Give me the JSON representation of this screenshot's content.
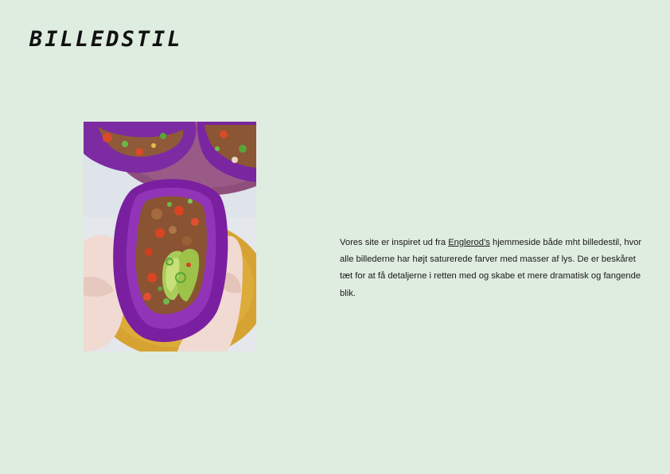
{
  "page": {
    "title": "BILLEDSTIL",
    "background_color": "#dfece0"
  },
  "photo": {
    "icon": "food-photo",
    "subject_colors": {
      "cabbage": "#7a1fa0",
      "plate_top": "#8a4a78",
      "plate_bottom": "#d8a534",
      "avocado": "#9cc24a",
      "hands": "#f1d9d0"
    }
  },
  "description": {
    "before_link": "Vores site er inspiret ud fra ",
    "link_text": "Englerod’s",
    "after_link": " hjemmeside både mht billedestil, hvor alle billederne har højt saturerede farver med masser af lys. De er beskåret tæt for at få detaljerne i retten med og skabe et mere dramatisk og fangende blik."
  }
}
